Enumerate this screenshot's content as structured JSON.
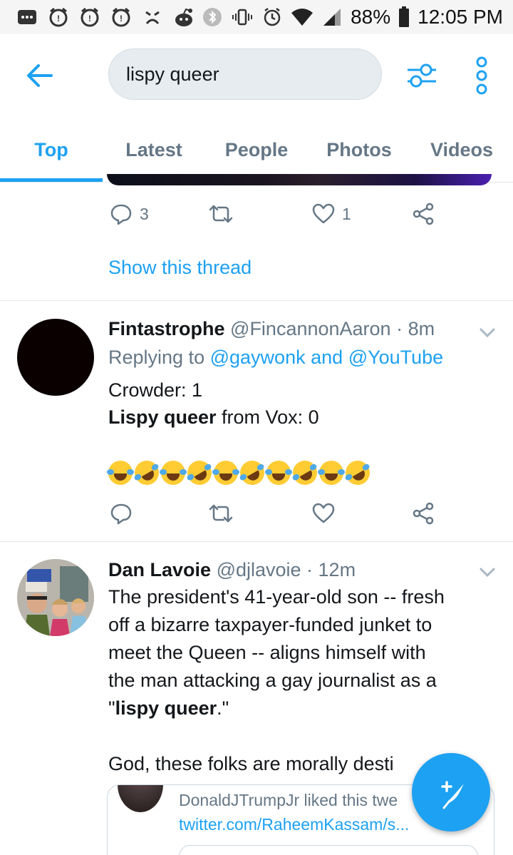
{
  "status_bar": {
    "battery": "88%",
    "time": "12:05 PM"
  },
  "search": {
    "query": "lispy queer"
  },
  "tabs": [
    {
      "label": "Top",
      "active": true
    },
    {
      "label": "Latest",
      "active": false
    },
    {
      "label": "People",
      "active": false
    },
    {
      "label": "Photos",
      "active": false
    },
    {
      "label": "Videos",
      "active": false
    }
  ],
  "prev_tweet": {
    "reply_count": "3",
    "like_count": "1",
    "show_thread": "Show this thread"
  },
  "tweet1": {
    "name": "Fintastrophe",
    "handle": "@FincannonAaron",
    "time": "· 8m",
    "replying_to_prefix": "Replying to",
    "mention1": "@gaywonk",
    "and_word": "and",
    "mention2": "@YouTube",
    "line1": "Crowder: 1",
    "line2_bold": "Lispy queer",
    "line2_rest": " from Vox: 0",
    "emoji_count": 10
  },
  "tweet2": {
    "name": "Dan Lavoie",
    "handle": "@djlavoie",
    "time": "· 12m",
    "lines": [
      "The president's 41-year-old son -- fresh",
      "off a bizarre taxpayer-funded junket to",
      "meet the Queen -- aligns himself with",
      "the man attacking a gay journalist as a"
    ],
    "quote_open": "\"",
    "quote_bold": "lispy queer",
    "quote_close": ".\"",
    "line_after": "God, these folks are morally desti",
    "card_line1": "DonaldJTrumpJr liked this twe",
    "card_line2": "twitter.com/RaheemKassam/s..."
  },
  "colors": {
    "accent": "#1da1f2",
    "secondary_text": "#657786",
    "primary_text": "#14171a"
  },
  "icons": {
    "back": "arrow-left-icon",
    "filter": "sliders-icon",
    "more": "vertical-dots-icon",
    "compose": "feather-plus-icon"
  }
}
